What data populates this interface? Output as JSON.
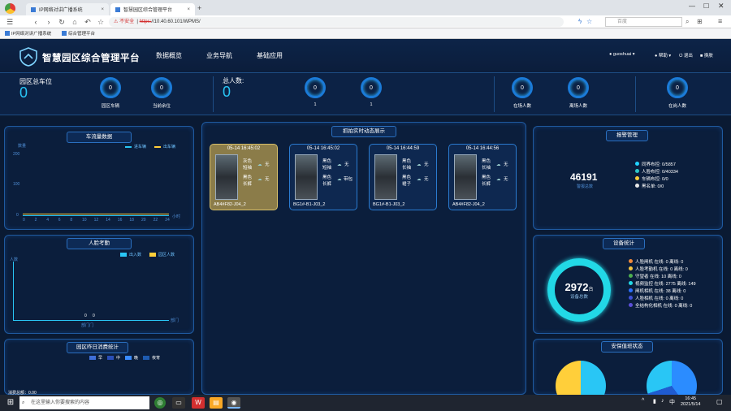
{
  "browser": {
    "tabs": [
      {
        "label": "IP网络对讲广播系统",
        "icon": "browser-page-icon"
      },
      {
        "label": "智慧园区综合管理平台",
        "icon": "browser-page-icon"
      }
    ],
    "security": "不安全",
    "url_scheme": "https:",
    "url_rest": "//10.40.60.101/WPMS/",
    "search_placeholder": "百度",
    "bookmarks": [
      "IP网络对讲广播系统",
      "综合管理平台"
    ]
  },
  "header": {
    "title": "智慧园区综合管理平台",
    "menu": [
      "数据概览",
      "业务导航",
      "基础应用"
    ],
    "user": "guoshuai",
    "help": "帮助",
    "logout": "退出",
    "skin": "换肤"
  },
  "stats": {
    "parking_label": "园区总车位",
    "parking_value": "0",
    "ring_car_value": "0",
    "ring_car_label": "园区车辆",
    "ring_remain_value": "0",
    "ring_remain_label": "当前余位",
    "people_label": "总人数:",
    "people_value": "0",
    "ring_p1_value": "0",
    "ring_p1_label": "1",
    "ring_p2_value": "0",
    "ring_p2_label": "1",
    "ring_zai_value": "0",
    "ring_zai_label": "在场人数",
    "ring_li_value": "0",
    "ring_li_label": "离场人数",
    "ring_gang_value": "0",
    "ring_gang_label": "在岗人数"
  },
  "traffic": {
    "title": "车流量数据",
    "ylabel": "数量",
    "legend_in": "进车辆",
    "legend_out": "出车辆",
    "yticks": [
      "200",
      "100",
      "0"
    ],
    "xticks": [
      "0",
      "2",
      "4",
      "6",
      "8",
      "10",
      "12",
      "14",
      "16",
      "18",
      "20",
      "22",
      "24"
    ],
    "xunit": "小时"
  },
  "face": {
    "title": "人脸考勤",
    "legend_a": "出入数",
    "legend_b": "园区人数",
    "yunit": "人数",
    "val_a": "0",
    "val_b": "0",
    "xlabel": "部门门",
    "xlabel2": "部门"
  },
  "consume": {
    "title": "园区昨日消费统计",
    "legend": [
      "早",
      "中",
      "晚",
      "夜宵"
    ],
    "legend_colors": [
      "#3f6fd8",
      "#2a4fb8",
      "#3a8cff",
      "#1e5bb0"
    ],
    "footer": "消费总额：0.00"
  },
  "capture": {
    "title": "抓拍实时动态展示",
    "cards": [
      {
        "time": "05-14 16:45:02",
        "a1": "灰色",
        "a2": "短袖",
        "a3": "黑色",
        "a4": "长裤",
        "bag": "无",
        "loc": "AB4#F82-J04_2",
        "selected": true
      },
      {
        "time": "05-14 16:45:02",
        "a1": "黑色",
        "a2": "短袖",
        "a3": "黑色",
        "a4": "长裤",
        "bag": "无",
        "bag2": "带包",
        "loc": "BG1#-B1-J03_2",
        "selected": false
      },
      {
        "time": "05-14 16:44:59",
        "a1": "黑色",
        "a2": "长袖",
        "a3": "黑色",
        "a4": "裙子",
        "bag": "无",
        "loc": "BG1#-B1-J03_2",
        "selected": false
      },
      {
        "time": "05-14 16:44:56",
        "a1": "黑色",
        "a2": "长袖",
        "a3": "黑色",
        "a4": "长裤",
        "bag": "无",
        "loc": "AB4#F82-J04_2",
        "selected": false
      }
    ]
  },
  "alarm": {
    "title": "报警管理",
    "total": "46191",
    "total_label": "警报总数",
    "items": [
      {
        "label": "同界布控: 0/5857",
        "color": "#21d3ff"
      },
      {
        "label": "人脸布控: 0/40334",
        "color": "#2ec7c9"
      },
      {
        "label": "车辆布控: 0/0",
        "color": "#ffcf3a"
      },
      {
        "label": "黑名单: 0/0",
        "color": "#e8e8e8"
      }
    ]
  },
  "device": {
    "title": "设备统计",
    "total": "2972",
    "unit": "台",
    "total_label": "设备总数",
    "items": [
      {
        "label": "人脸闸机  在线: 0 离线: 0",
        "color": "#f08a3c"
      },
      {
        "label": "人脸考勤机  在线: 0 离线: 0",
        "color": "#f5c542"
      },
      {
        "label": "守望者  在线: 10 离线: 0",
        "color": "#4caf50"
      },
      {
        "label": "视频监控  在线: 2775 离线: 149",
        "color": "#22d8e6"
      },
      {
        "label": "闸机相机  在线: 38 离线: 0",
        "color": "#2b6fff"
      },
      {
        "label": "人脸相机  在线: 0 离线: 0",
        "color": "#3f51d8"
      },
      {
        "label": "全结构化相机  在线: 0 离线: 0",
        "color": "#5b4fd8"
      }
    ]
  },
  "security_status": {
    "title": "安保值班状态"
  },
  "taskbar": {
    "search_placeholder": "在这里输入你要搜索的内容",
    "time": "16:45",
    "date": "2021/5/14",
    "ime": "中"
  }
}
